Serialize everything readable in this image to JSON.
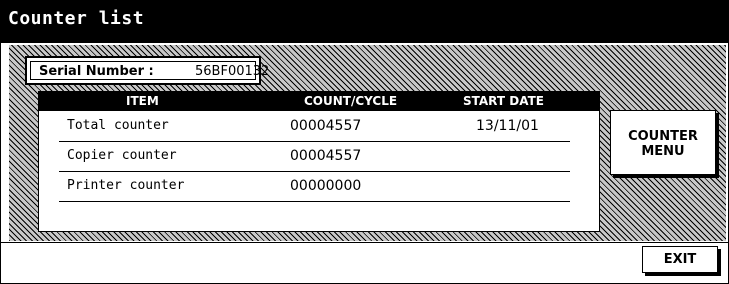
{
  "window": {
    "title": "Counter list"
  },
  "serial": {
    "label": "Serial Number  :",
    "value": "56BF00132"
  },
  "table": {
    "headers": [
      "ITEM",
      "COUNT/CYCLE",
      "START DATE"
    ],
    "rows": [
      {
        "item": "Total counter",
        "count": "00004557",
        "start_date": "13/11/01"
      },
      {
        "item": "Copier counter",
        "count": "00004557",
        "start_date": ""
      },
      {
        "item": "Printer counter",
        "count": "00000000",
        "start_date": ""
      }
    ]
  },
  "buttons": {
    "counter_menu_line1": "COUNTER",
    "counter_menu_line2": "MENU",
    "exit": "EXIT"
  },
  "colors": {
    "foreground": "#000000",
    "background": "#ffffff",
    "hatch": "#c8c8c8"
  }
}
